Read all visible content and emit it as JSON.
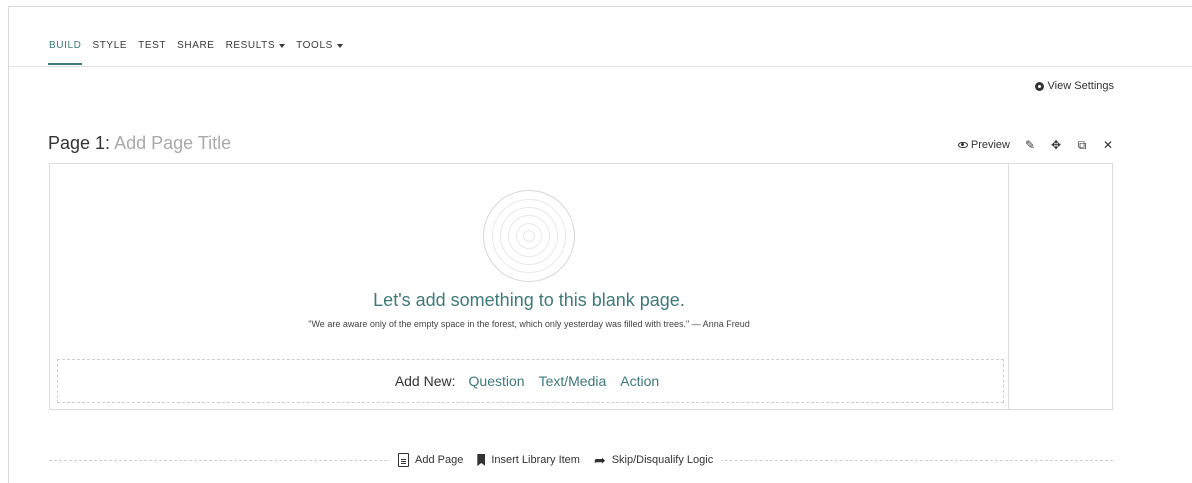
{
  "nav": {
    "tabs": [
      {
        "label": "BUILD",
        "active": true,
        "dropdown": false
      },
      {
        "label": "STYLE",
        "active": false,
        "dropdown": false
      },
      {
        "label": "TEST",
        "active": false,
        "dropdown": false
      },
      {
        "label": "SHARE",
        "active": false,
        "dropdown": false
      },
      {
        "label": "RESULTS",
        "active": false,
        "dropdown": true
      },
      {
        "label": "TOOLS",
        "active": false,
        "dropdown": true
      }
    ]
  },
  "view_settings": {
    "label": "View Settings",
    "icon": "gear-icon"
  },
  "page": {
    "title_prefix": "Page 1:",
    "title_placeholder": "Add Page Title",
    "actions": {
      "preview_label": "Preview",
      "icons": [
        "pencil-icon",
        "move-icon",
        "copy-icon",
        "close-icon"
      ]
    },
    "empty_state": {
      "heading": "Let's add something to this blank page.",
      "quote": "\"We are aware only of the empty space in the forest, which only yesterday was filled with trees.\" — Anna Freud"
    },
    "add_new": {
      "label": "Add New:",
      "links": [
        "Question",
        "Text/Media",
        "Action"
      ]
    }
  },
  "bottom_actions": {
    "add_page": "Add Page",
    "insert_library": "Insert Library Item",
    "skip_logic": "Skip/Disqualify Logic"
  },
  "colors": {
    "accent": "#3d7a79",
    "text": "#333333",
    "border": "#dcdcdc"
  }
}
